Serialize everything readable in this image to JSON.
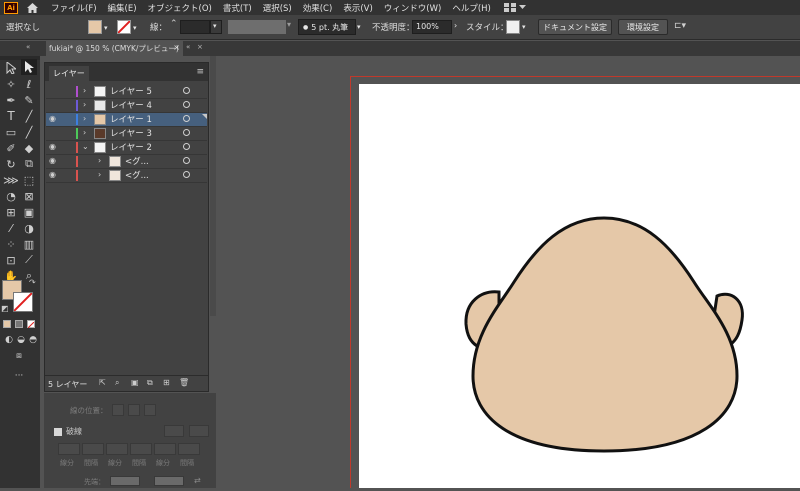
{
  "menubar": {
    "logo": "Ai",
    "items": [
      "ファイル(F)",
      "編集(E)",
      "オブジェクト(O)",
      "書式(T)",
      "選択(S)",
      "効果(C)",
      "表示(V)",
      "ウィンドウ(W)",
      "ヘルプ(H)"
    ]
  },
  "control_bar": {
    "selection_status": "選択なし",
    "stroke_label": "線：",
    "brush_value": "5 pt. 丸筆",
    "opacity_label": "不透明度：",
    "opacity_value": "100%",
    "style_label": "スタイル：",
    "document_setup_button": "ドキュメント設定",
    "preferences_button": "環境設定",
    "fill_color": "#e5c8a8"
  },
  "document_tab": {
    "title": "fukiai* @ 150 % (CMYK/プレビュー)",
    "close": "×"
  },
  "layers_panel": {
    "tab_label": "レイヤー",
    "rows": [
      {
        "name": "レイヤー 5",
        "color": "#b04fcf",
        "visible": false,
        "indent": 0,
        "expanded": false,
        "selected": false
      },
      {
        "name": "レイヤー 4",
        "color": "#6d5ad6",
        "visible": false,
        "indent": 0,
        "expanded": false,
        "selected": false
      },
      {
        "name": "レイヤー 1",
        "color": "#3d7fe0",
        "visible": true,
        "indent": 0,
        "expanded": false,
        "selected": true
      },
      {
        "name": "レイヤー 3",
        "color": "#4dc95a",
        "visible": false,
        "indent": 0,
        "expanded": false,
        "selected": false
      },
      {
        "name": "レイヤー 2",
        "color": "#d9534f",
        "visible": true,
        "indent": 0,
        "expanded": true,
        "selected": false
      },
      {
        "name": "<グ...",
        "color": "#d9534f",
        "visible": true,
        "indent": 1,
        "expanded": false,
        "selected": false
      },
      {
        "name": "<グ...",
        "color": "#d9534f",
        "visible": true,
        "indent": 1,
        "expanded": false,
        "selected": false
      }
    ],
    "footer_count": "5 レイヤー"
  },
  "stroke_panel": {
    "alignment_label": "線の位置：",
    "dashed_label": "破線",
    "dash_label": "線分",
    "gap_label": "間隔",
    "arrow_start_label": "先端："
  },
  "colors": {
    "face_fill": "#e5c8a8",
    "face_stroke": "#111111",
    "accent_selection": "#46607e",
    "artboard_bleed": "#c0392b"
  }
}
